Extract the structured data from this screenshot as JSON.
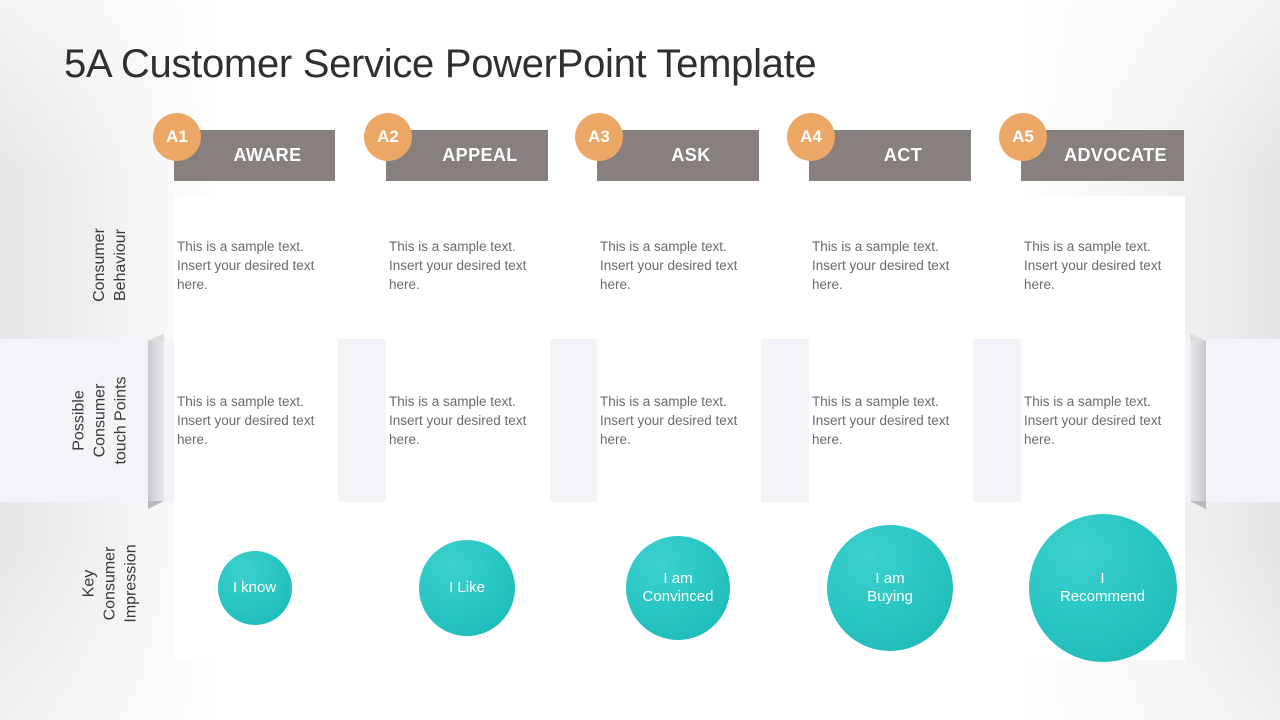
{
  "slide": {
    "title": "5A Customer Service PowerPoint Template",
    "colors": {
      "badge": "#eca766",
      "header_bar": "#87807e",
      "bubble": "#2ec9c6",
      "band": "#f2f4f8",
      "body_text": "#6b6b6b",
      "title_text": "#2f2f2f"
    }
  },
  "rows": [
    {
      "label": "Consumer\nBehaviour"
    },
    {
      "label": "Possible\nConsumer\ntouch Points"
    },
    {
      "label": "Key\nConsumer\nImpression"
    }
  ],
  "row_labels": {
    "r0": [
      "Consumer",
      "Behaviour"
    ],
    "r1": [
      "Possible",
      "Consumer",
      "touch Points"
    ],
    "r2": [
      "Key",
      "Consumer",
      "Impression"
    ]
  },
  "sample_text": "This is a sample text. Insert your desired text here.",
  "columns": [
    {
      "badge": "A1",
      "title": "AWARE",
      "behaviour": "This is a sample text. Insert your desired text here.",
      "touchpoints": "This is a sample text. Insert your desired text here.",
      "impression": "I know",
      "impression_lines": [
        "I know"
      ],
      "bubble_diameter": 74
    },
    {
      "badge": "A2",
      "title": "APPEAL",
      "behaviour": "This is a sample text. Insert your desired text here.",
      "touchpoints": "This is a sample text. Insert your desired text here.",
      "impression": "I Like",
      "impression_lines": [
        "I Like"
      ],
      "bubble_diameter": 96
    },
    {
      "badge": "A3",
      "title": "ASK",
      "behaviour": "This is a sample text. Insert your desired text here.",
      "touchpoints": "This is a sample text. Insert your desired text here.",
      "impression": "I am Convinced",
      "impression_lines": [
        "I am",
        "Convinced"
      ],
      "bubble_diameter": 104
    },
    {
      "badge": "A4",
      "title": "ACT",
      "behaviour": "This is a sample text. Insert your desired text here.",
      "touchpoints": "This is a sample text. Insert your desired text here.",
      "impression": "I am Buying",
      "impression_lines": [
        "I am",
        "Buying"
      ],
      "bubble_diameter": 126
    },
    {
      "badge": "A5",
      "title": "ADVOCATE",
      "behaviour": "This is a sample text. Insert your desired text here.",
      "touchpoints": "This is a sample text. Insert your desired text here.",
      "impression": "I Recommend",
      "impression_lines": [
        "I",
        "Recommend"
      ],
      "bubble_diameter": 148
    }
  ]
}
